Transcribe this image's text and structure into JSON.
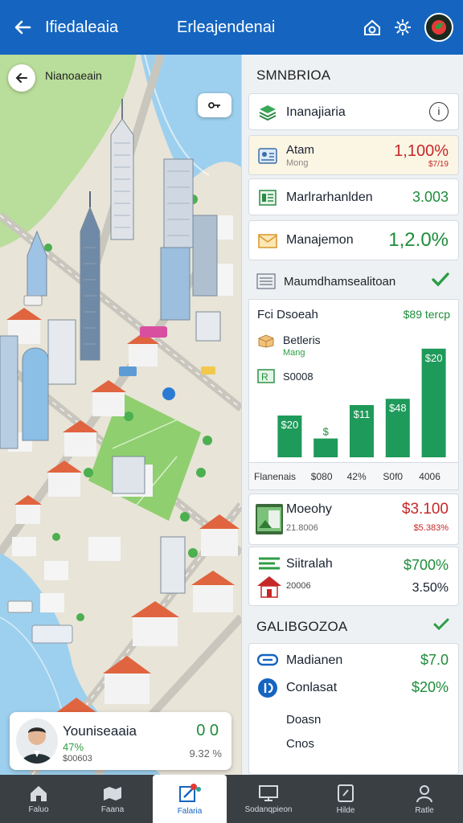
{
  "topbar": {
    "app_title": "Ifiedaleaia",
    "center_title": "Erleajendenai",
    "colors": {
      "bar": "#1565c0"
    }
  },
  "map": {
    "label": "Nianoaeain"
  },
  "person_card": {
    "name": "Youniseaaia",
    "pct": "47%",
    "sub": "$00603",
    "value": "0 0",
    "value2": "9.32 %"
  },
  "summary": {
    "heading": "SMNBRIOA",
    "items": [
      {
        "label": "Inanajiaria",
        "value": "",
        "icon": "stack-icon"
      },
      {
        "label": "Atam",
        "sub": "Mong",
        "value": "1,100%",
        "sub_value": "$7/19",
        "icon": "id-card-icon"
      },
      {
        "label": "Marlrarhanlden",
        "value": "3.003",
        "icon": "list-icon"
      },
      {
        "label": "Manajemon",
        "value": "1,2.0%",
        "icon": "mail-icon"
      }
    ],
    "section2_heading": "Maumdhamsealitoan",
    "colors": {
      "green": "#1e8c3a",
      "red": "#c62828"
    }
  },
  "chart_card": {
    "title": "Fci Dsoeah",
    "title_value": "$89 tercp",
    "entry1_label": "Betleris",
    "entry1_sub": "Mang",
    "entry2_label": "S0008"
  },
  "chart_data": {
    "type": "bar",
    "categories": [
      "Flanenais",
      "$080",
      "42%",
      "S0f0",
      "4006"
    ],
    "values": [
      20,
      9,
      25,
      28,
      52
    ],
    "data_labels": [
      "$20",
      "$",
      "$11",
      "$48",
      "$20"
    ],
    "title": "",
    "ylim": [
      0,
      60
    ],
    "bar_color": "#1e9a5a"
  },
  "list": [
    {
      "label": "Moeohy",
      "sub": "21.8006",
      "value": "$3.100",
      "sub_value": "$5.383%",
      "value_color": "#c62828"
    },
    {
      "label": "Siitralah",
      "sub": "20006",
      "value": "$700%",
      "sub_value": "3.50%",
      "value_color": "#1e8c3a"
    }
  ],
  "gallery": {
    "heading": "GALIBGOZOA",
    "items": [
      {
        "label": "Madianen",
        "value": "$7.0"
      },
      {
        "label": "Conlasat",
        "value": "$20%"
      },
      {
        "label": "Doasn",
        "value": ""
      },
      {
        "label": "Cnos",
        "value": ""
      }
    ]
  },
  "bottom_nav": [
    {
      "label": "Faluo",
      "icon": "home-icon"
    },
    {
      "label": "Faana",
      "icon": "map-icon"
    },
    {
      "label": "Falaria",
      "icon": "edit-icon"
    },
    {
      "label": "Sodanqpieon",
      "icon": "monitor-icon"
    },
    {
      "label": "Hilde",
      "icon": "tablet-icon"
    },
    {
      "label": "Ratle",
      "icon": "person-icon"
    }
  ]
}
